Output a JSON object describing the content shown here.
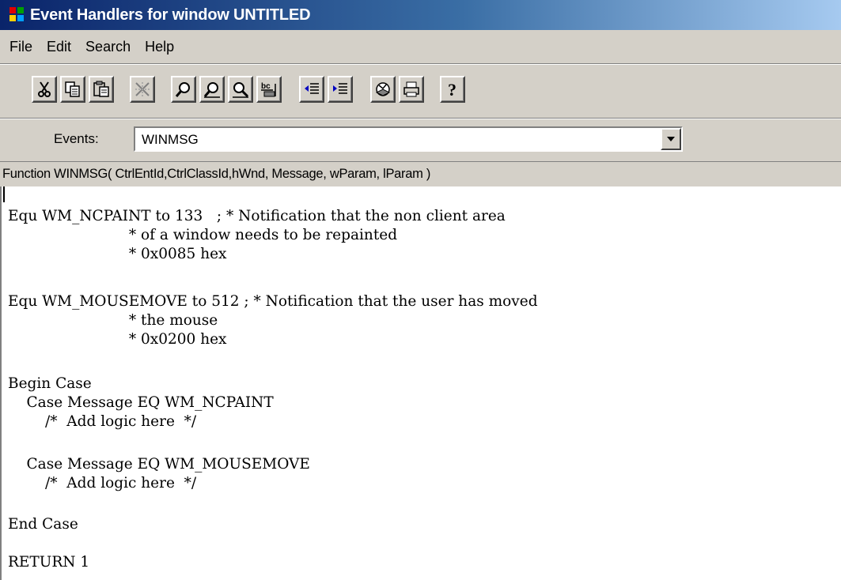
{
  "window": {
    "title": "Event Handlers for window UNTITLED"
  },
  "menu": [
    "File",
    "Edit",
    "Search",
    "Help"
  ],
  "toolbar": {
    "buttons": [
      {
        "name": "cut-icon"
      },
      {
        "name": "copy-icon"
      },
      {
        "name": "paste-icon"
      },
      {
        "name": "clear-icon"
      },
      {
        "name": "find-icon"
      },
      {
        "name": "find-next-icon"
      },
      {
        "name": "zoom-icon"
      },
      {
        "name": "replace-icon"
      },
      {
        "name": "outdent-icon"
      },
      {
        "name": "indent-icon"
      },
      {
        "name": "compile-icon"
      },
      {
        "name": "print-icon"
      },
      {
        "name": "help-icon"
      }
    ]
  },
  "events": {
    "label": "Events:",
    "value": "WINMSG"
  },
  "signature": "Function WINMSG( CtrlEntId,CtrlClassId,hWnd, Message, wParam, lParam )",
  "code": [
    "Equ WM_NCPAINT to 133   ; * Notification that the non client area",
    "                          * of a window needs to be repainted",
    "                          * 0x0085 hex",
    "",
    "Equ WM_MOUSEMOVE to 512 ; * Notification that the user has moved",
    "                          * the mouse",
    "                          * 0x0200 hex",
    "",
    "Begin Case",
    "    Case Message EQ WM_NCPAINT",
    "        /*  Add logic here  */",
    "",
    "    Case Message EQ WM_MOUSEMOVE",
    "        /*  Add logic here  */",
    "",
    "End Case",
    "",
    "RETURN 1"
  ]
}
